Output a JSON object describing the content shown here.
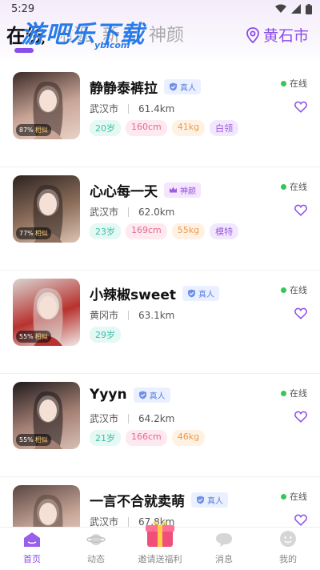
{
  "status": {
    "time": "5:29"
  },
  "header": {
    "tabs": [
      {
        "label": "在线",
        "active": true
      },
      {
        "label": "附近",
        "active": false
      },
      {
        "label": "新人",
        "active": false
      },
      {
        "label": "神颜",
        "active": false
      }
    ],
    "city": "黄石市",
    "watermark": "游吧乐下载",
    "watermark_sub": "yblcom"
  },
  "colors": {
    "accent": "#8a4de9",
    "online": "#35c759"
  },
  "users": [
    {
      "name": "静静泰裤拉",
      "badge": "真人",
      "badge_type": "real",
      "city": "武汉市",
      "distance": "61.4km",
      "similarity": "87%",
      "similar_label": "相似",
      "status": "在线",
      "tags": [
        {
          "text": "20岁",
          "type": "age"
        },
        {
          "text": "160cm",
          "type": "height"
        },
        {
          "text": "41kg",
          "type": "weight"
        },
        {
          "text": "白领",
          "type": "job"
        }
      ]
    },
    {
      "name": "心心每一天",
      "badge": "神颜",
      "badge_type": "goddess",
      "city": "武汉市",
      "distance": "62.0km",
      "similarity": "77%",
      "similar_label": "相似",
      "status": "在线",
      "tags": [
        {
          "text": "23岁",
          "type": "age"
        },
        {
          "text": "169cm",
          "type": "height"
        },
        {
          "text": "55kg",
          "type": "weight"
        },
        {
          "text": "模特",
          "type": "job"
        }
      ]
    },
    {
      "name": "小辣椒sweet",
      "badge": "真人",
      "badge_type": "real",
      "city": "黄冈市",
      "distance": "63.1km",
      "similarity": "55%",
      "similar_label": "相似",
      "status": "在线",
      "tags": [
        {
          "text": "29岁",
          "type": "age"
        }
      ]
    },
    {
      "name": "Yyyn",
      "badge": "真人",
      "badge_type": "real",
      "city": "武汉市",
      "distance": "64.2km",
      "similarity": "55%",
      "similar_label": "相似",
      "status": "在线",
      "tags": [
        {
          "text": "21岁",
          "type": "age"
        },
        {
          "text": "166cm",
          "type": "height"
        },
        {
          "text": "46kg",
          "type": "weight"
        }
      ]
    },
    {
      "name": "一言不合就卖萌",
      "badge": "真人",
      "badge_type": "real",
      "city": "武汉市",
      "distance": "67.8km",
      "similarity": "",
      "similar_label": "",
      "status": "在线",
      "tags": []
    }
  ],
  "nav": [
    {
      "label": "首页",
      "icon": "home-icon",
      "active": true
    },
    {
      "label": "动态",
      "icon": "planet-icon",
      "active": false
    },
    {
      "label": "邀请送福利",
      "icon": "gift-icon",
      "active": false
    },
    {
      "label": "消息",
      "icon": "message-icon",
      "active": false
    },
    {
      "label": "我的",
      "icon": "profile-icon",
      "active": false
    }
  ]
}
